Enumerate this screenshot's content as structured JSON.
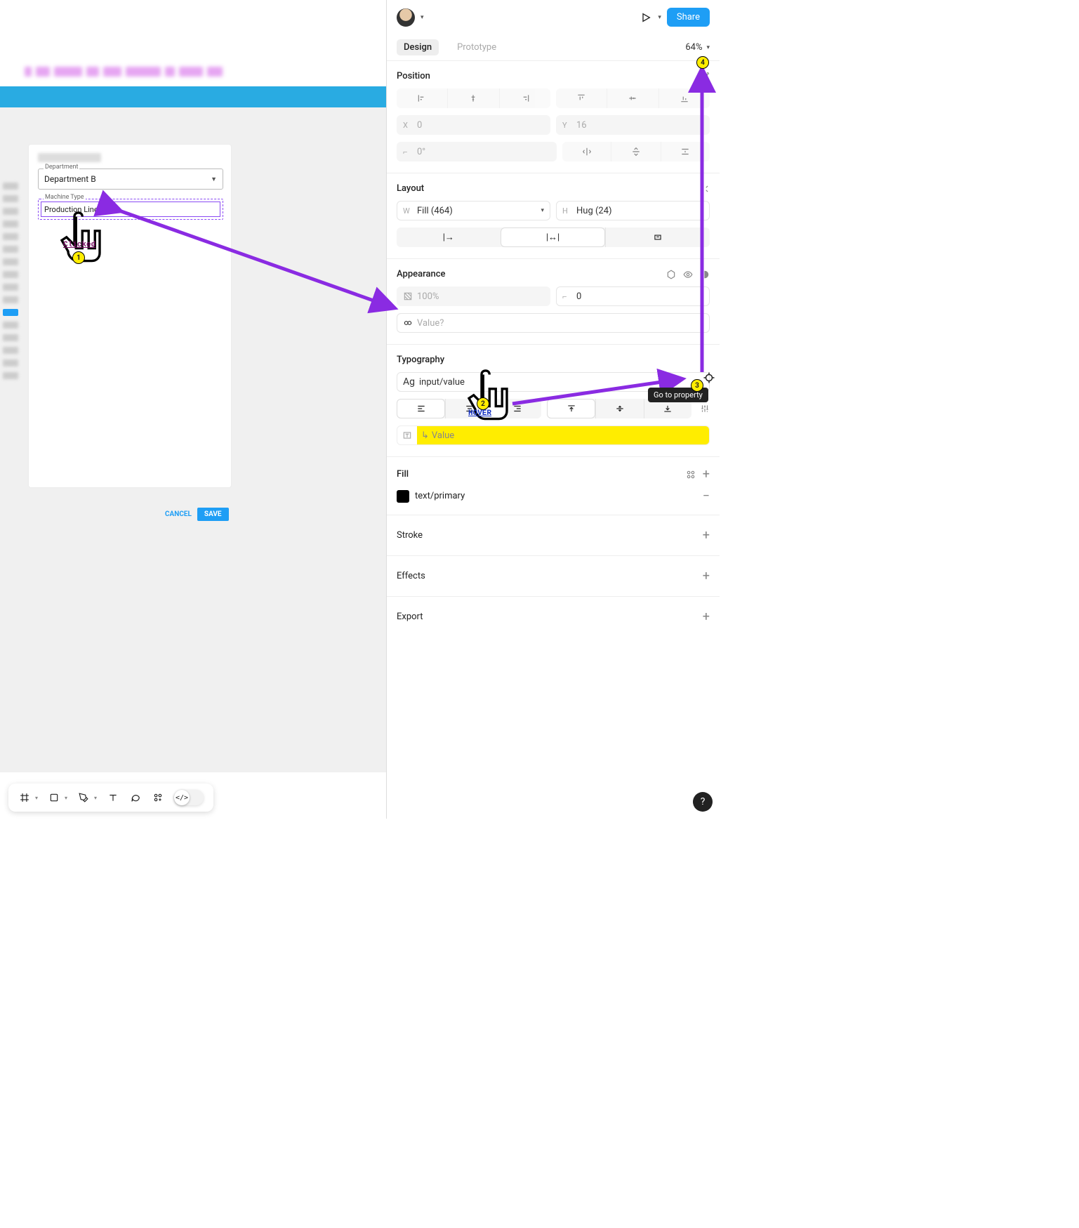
{
  "canvas": {
    "department_label": "Department",
    "department_value": "Department B",
    "machine_label": "Machine Type",
    "machine_value": "Production Line 999",
    "cancel": "CANCEL",
    "save": "SAVE"
  },
  "annotations": {
    "clicked": "Clicked",
    "hover": "HOVER",
    "tooltip": "Go to property",
    "n1": "1",
    "n2": "2",
    "n3": "3",
    "n4": "4"
  },
  "header": {
    "share": "Share",
    "tab_design": "Design",
    "tab_prototype": "Prototype",
    "zoom": "64%"
  },
  "position": {
    "title": "Position",
    "x_label": "X",
    "x_value": "0",
    "y_label": "Y",
    "y_value": "16",
    "rotation": "0°"
  },
  "layout": {
    "title": "Layout",
    "w_label": "W",
    "w_value": "Fill (464)",
    "h_label": "H",
    "h_value": "Hug (24)"
  },
  "appearance": {
    "title": "Appearance",
    "opacity": "100%",
    "radius": "0",
    "value_placeholder": "Value?"
  },
  "typography": {
    "title": "Typography",
    "style_prefix": "Ag",
    "style_value": "input/value",
    "prop_placeholder": "Value"
  },
  "fill": {
    "title": "Fill",
    "value": "text/primary"
  },
  "sections": {
    "stroke": "Stroke",
    "effects": "Effects",
    "export": "Export"
  },
  "help": "?"
}
